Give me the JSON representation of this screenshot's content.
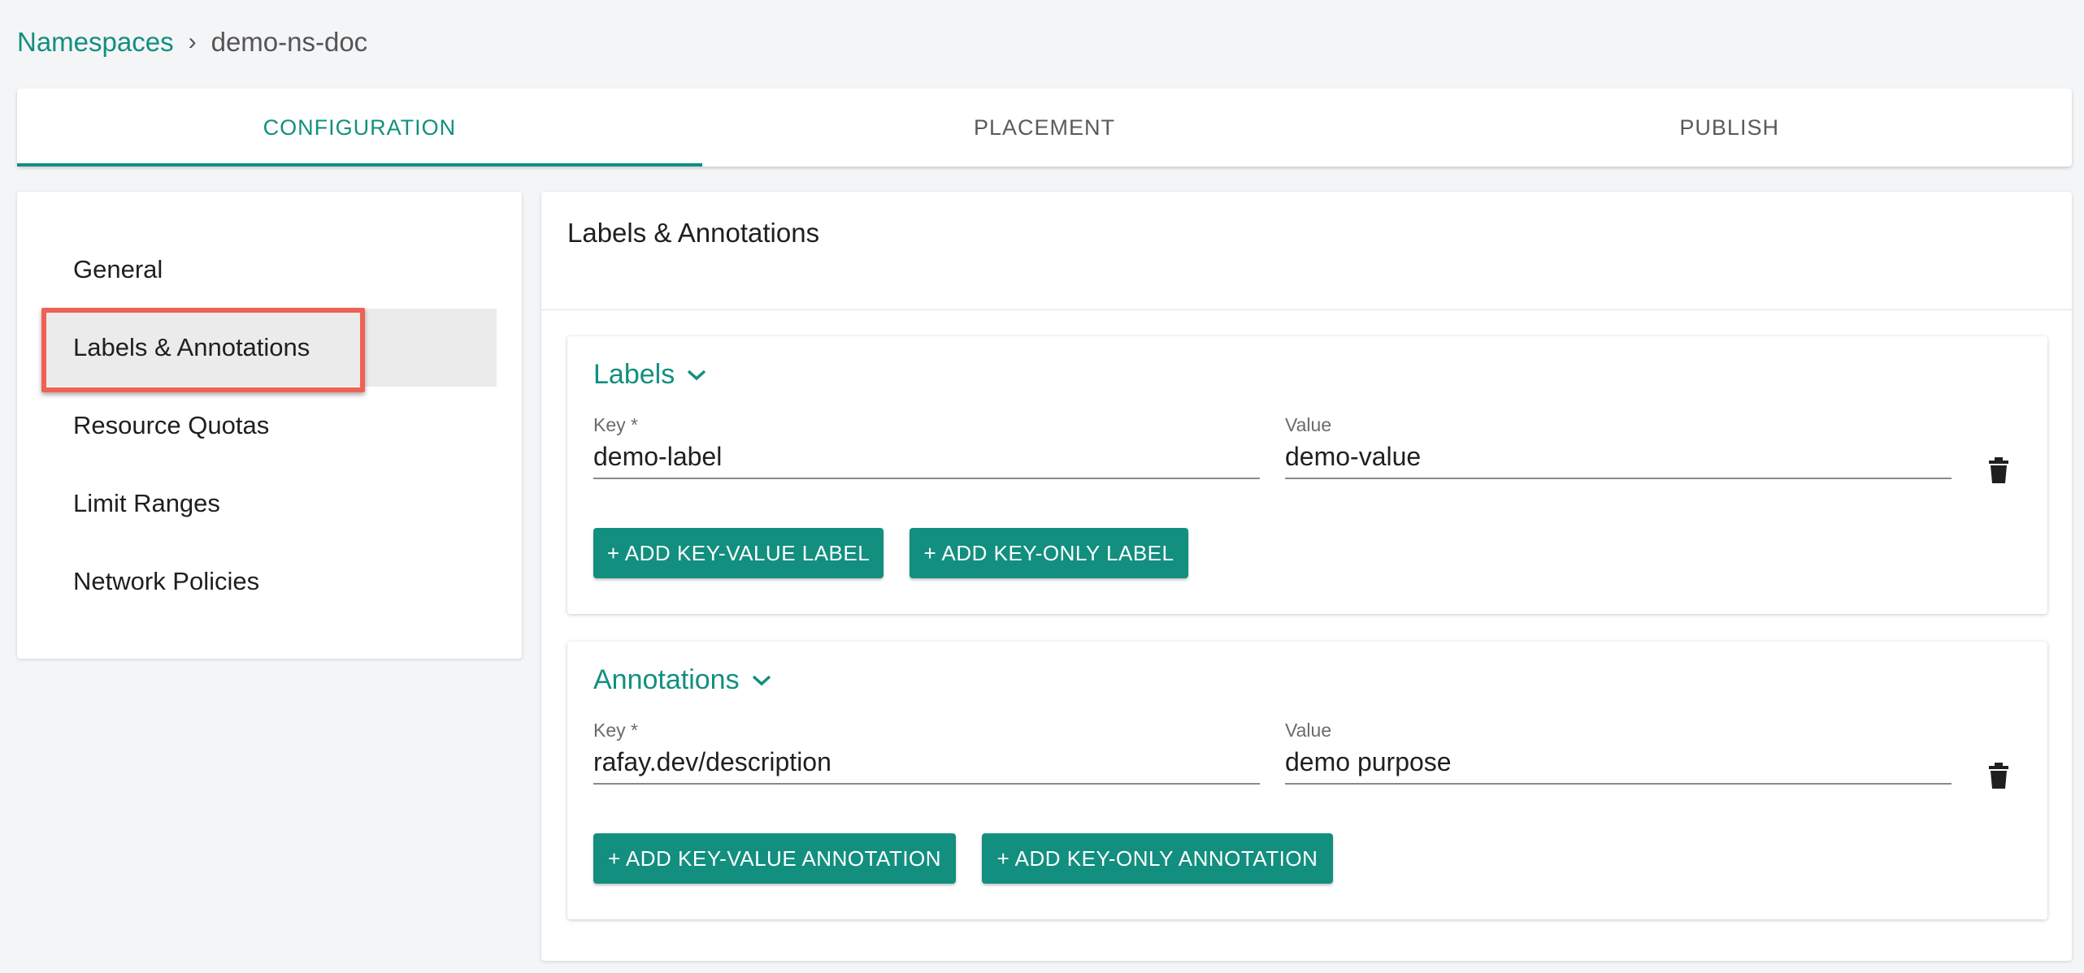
{
  "breadcrumb": {
    "root": "Namespaces",
    "separator": "›",
    "current": "demo-ns-doc"
  },
  "tabs": [
    {
      "label": "CONFIGURATION",
      "active": true
    },
    {
      "label": "PLACEMENT",
      "active": false
    },
    {
      "label": "PUBLISH",
      "active": false
    }
  ],
  "sidenav": {
    "items": [
      {
        "label": "General"
      },
      {
        "label": "Labels & Annotations",
        "selected": true
      },
      {
        "label": "Resource Quotas"
      },
      {
        "label": "Limit Ranges"
      },
      {
        "label": "Network Policies"
      }
    ]
  },
  "content": {
    "title": "Labels & Annotations",
    "labels": {
      "title": "Labels",
      "icon": "chevron-down-icon",
      "key_label": "Key *",
      "key_value": "demo-label",
      "value_label": "Value",
      "value_value": "demo-value",
      "delete_icon": "trash-icon",
      "btn_key_value": "+ ADD KEY-VALUE LABEL",
      "btn_key_only": "+ ADD KEY-ONLY LABEL"
    },
    "annotations": {
      "title": "Annotations",
      "icon": "chevron-down-icon",
      "key_label": "Key *",
      "key_value": "rafay.dev/description",
      "value_label": "Value",
      "value_value": "demo purpose",
      "delete_icon": "trash-icon",
      "btn_key_value": "+ ADD KEY-VALUE ANNOTATION",
      "btn_key_only": "+ ADD KEY-ONLY ANNOTATION"
    }
  },
  "colors": {
    "accent": "#128f7f",
    "highlight": "#ef6152",
    "background": "#f4f5f7"
  }
}
